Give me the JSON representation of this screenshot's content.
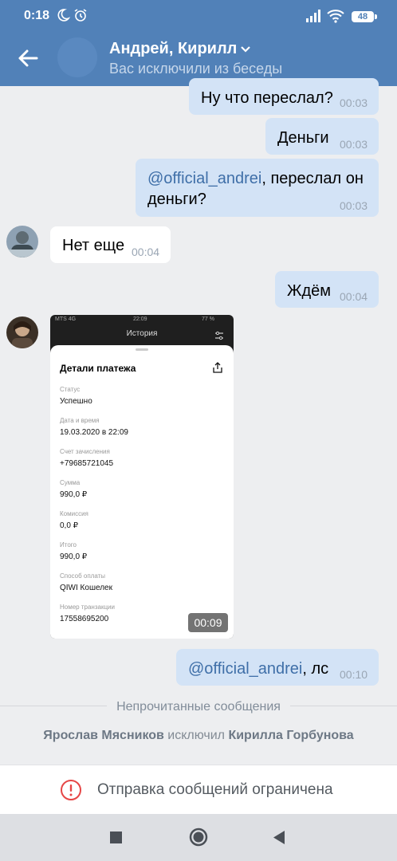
{
  "status_bar": {
    "time": "0:18",
    "battery": "48"
  },
  "header": {
    "title": "Андрей, Кирилл",
    "subtitle": "Вас исключили из беседы"
  },
  "messages": [
    {
      "dir": "out",
      "text": "Ну что переслал?",
      "time": "00:03"
    },
    {
      "dir": "out",
      "text": "Деньги",
      "time": "00:03"
    },
    {
      "dir": "out",
      "mention": "@official_andrei",
      "text": ",  переслал он",
      "text2": "деньги?",
      "time": "00:03"
    },
    {
      "dir": "in",
      "text": "Нет еще",
      "time": "00:04"
    },
    {
      "dir": "out",
      "text": "Ждём",
      "time": "00:04"
    },
    {
      "dir": "out",
      "mention": "@official_andrei",
      "text": ",  лс",
      "time": "00:10"
    }
  ],
  "shot": {
    "carrier": "MTS 4G",
    "clock": "22:09",
    "battery": "77 %",
    "screen_title": "История",
    "card_title": "Детали платежа",
    "fields": [
      {
        "label": "Статус",
        "value": "Успешно"
      },
      {
        "label": "Дата и время",
        "value": "19.03.2020 в 22:09"
      },
      {
        "label": "Счет зачисления",
        "value": "+79685721045"
      },
      {
        "label": "Сумма",
        "value": "990,0 ₽"
      },
      {
        "label": "Комиссия",
        "value": "0,0 ₽"
      },
      {
        "label": "Итого",
        "value": "990,0 ₽"
      },
      {
        "label": "Способ оплаты",
        "value": "QIWI Кошелек"
      },
      {
        "label": "Номер транзакции",
        "value": "17558695200"
      }
    ],
    "duration": "00:09"
  },
  "unread": "Непрочитанные сообщения",
  "system": {
    "actor": "Ярослав Мясников",
    "action": " исключил ",
    "target": "Кирилла Горбунова"
  },
  "restriction": "Отправка сообщений ограничена",
  "colors": {
    "header": "#5181b8",
    "outgoing": "#d3e3f6",
    "incoming": "#ffffff",
    "background": "#edeef0",
    "alert": "#e64646"
  }
}
